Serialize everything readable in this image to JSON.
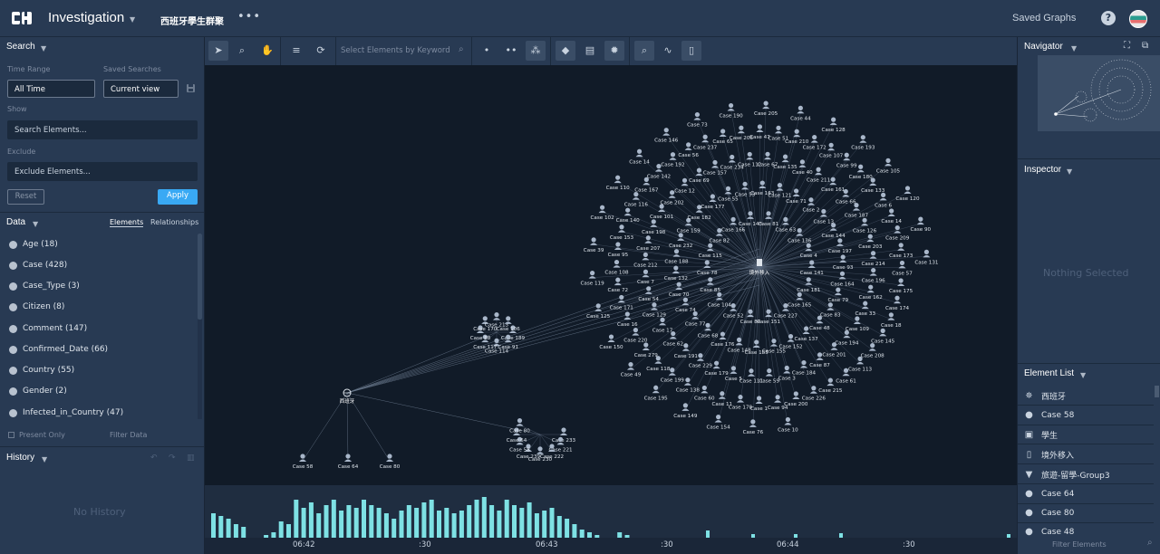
{
  "topbar": {
    "app_title": "Investigation",
    "graph_name": "西班牙學生群聚",
    "more": "•••",
    "saved_graphs": "Saved Graphs",
    "help": "?"
  },
  "search": {
    "title": "Search",
    "time_range_label": "Time Range",
    "time_range_value": "All Time",
    "saved_searches_label": "Saved Searches",
    "saved_searches_value": "Current view",
    "show_label": "Show",
    "show_placeholder": "Search Elements...",
    "exclude_label": "Exclude",
    "exclude_placeholder": "Exclude Elements...",
    "reset": "Reset",
    "apply": "Apply"
  },
  "data_panel": {
    "title": "Data",
    "tab_elements": "Elements",
    "tab_relationships": "Relationships",
    "items": [
      "Age (18)",
      "Case (428)",
      "Case_Type (3)",
      "Citizen (8)",
      "Comment (147)",
      "Confirmed_Date (66)",
      "Country (55)",
      "Gender (2)",
      "Infected_in_Country (47)"
    ],
    "present_only": "Present Only",
    "filter_data": "Filter Data"
  },
  "history": {
    "title": "History",
    "empty": "No History"
  },
  "toolbar": {
    "keyword_placeholder": "Select Elements by Keyword"
  },
  "graph": {
    "hub_label": "境外移入",
    "spain_label": "西班牙",
    "ring_labels": [
      "Case 141",
      "Case 181",
      "Case 165",
      "Case 227",
      "Case 151",
      "Case 84",
      "Case 52",
      "Case 104",
      "Case 85",
      "Case 78",
      "Case 115",
      "Case 82",
      "Case 166",
      "Case 143",
      "Case 81",
      "Case 63",
      "Case 136",
      "Case 4",
      "Case 79",
      "Case 83",
      "Case 48",
      "Case 137",
      "Case 152",
      "Case 155",
      "Case 185",
      "Case 148",
      "Case 176",
      "Case 68",
      "Case 77",
      "Case 74",
      "Case 70",
      "Case 132",
      "Case 188",
      "Case 232",
      "Case 159",
      "Case 182",
      "Case 177",
      "Case 55",
      "Case 53",
      "Case 163",
      "Case 121",
      "Case 71",
      "Case 2",
      "Case 13",
      "Case 144",
      "Case 197",
      "Case 93",
      "Case 164",
      "Case 194",
      "Case 201",
      "Case 87",
      "Case 184",
      "Case 3",
      "Case 59",
      "Case 111",
      "Case 5",
      "Case 179",
      "Case 229",
      "Case 191",
      "Case 62",
      "Case 17",
      "Case 129",
      "Case 54",
      "Case 7",
      "Case 212",
      "Case 207",
      "Case 198",
      "Case 101",
      "Case 202",
      "Case 12",
      "Case 69",
      "Case 157",
      "Case 234",
      "Case 112",
      "Case 67",
      "Case 135",
      "Case 40",
      "Case 211",
      "Case 161",
      "Case 66",
      "Case 187",
      "Case 126",
      "Case 203",
      "Case 214",
      "Case 196",
      "Case 162",
      "Case 33",
      "Case 109",
      "Case 215",
      "Case 226",
      "Case 200",
      "Case 94",
      "Case 1",
      "Case 178",
      "Case 11",
      "Case 60",
      "Case 138",
      "Case 199",
      "Case 118",
      "Case 279",
      "Case 220",
      "Case 16",
      "Case 171",
      "Case 72",
      "Case 108",
      "Case 95",
      "Case 153",
      "Case 140",
      "Case 116",
      "Case 167",
      "Case 142",
      "Case 192",
      "Case 56",
      "Case 237",
      "Case 65",
      "Case 206",
      "Case 47",
      "Case 51",
      "Case 210",
      "Case 172",
      "Case 107",
      "Case 99",
      "Case 180",
      "Case 133",
      "Case 6",
      "Case 14",
      "Case 209",
      "Case 173",
      "Case 57",
      "Case 175",
      "Case 174",
      "Case 18",
      "Case 145",
      "Case 208",
      "Case 113",
      "Case 61",
      "Case 10",
      "Case 76",
      "Case 154",
      "Case 149",
      "Case 195",
      "Case 49",
      "Case 150",
      "Case 125",
      "Case 119",
      "Case 39",
      "Case 102",
      "Case 110",
      "Case 14",
      "Case 146",
      "Case 73",
      "Case 190",
      "Case 205",
      "Case 44",
      "Case 128",
      "Case 193",
      "Case 105",
      "Case 120",
      "Case 90",
      "Case 131",
      "Case 189",
      "Case 91",
      "Case 114",
      "Case 117",
      "Case 88",
      "Case 170",
      "Case 213",
      "Case 106",
      "Case 233",
      "Case 221",
      "Case 222",
      "Case 230",
      "Case 239",
      "Case 58",
      "Case 64",
      "Case 80"
    ]
  },
  "timeline": {
    "ticks": [
      "06:42",
      ":30",
      "06:43",
      ":30",
      "06:44",
      ":30"
    ],
    "bars": [
      0.45,
      0.4,
      0.35,
      0.25,
      0.2,
      0.0,
      0.0,
      0.05,
      0.1,
      0.3,
      0.25,
      0.7,
      0.55,
      0.65,
      0.45,
      0.6,
      0.7,
      0.5,
      0.6,
      0.55,
      0.7,
      0.6,
      0.55,
      0.45,
      0.35,
      0.5,
      0.6,
      0.55,
      0.65,
      0.7,
      0.5,
      0.55,
      0.45,
      0.5,
      0.6,
      0.7,
      0.75,
      0.6,
      0.5,
      0.7,
      0.6,
      0.55,
      0.65,
      0.45,
      0.5,
      0.55,
      0.4,
      0.35,
      0.25,
      0.15,
      0.1,
      0.05,
      0.0,
      0.0,
      0.1,
      0.05,
      0.0,
      0.0,
      0.0
    ]
  },
  "navigator": {
    "title": "Navigator"
  },
  "inspector": {
    "title": "Inspector",
    "empty": "Nothing Selected"
  },
  "element_list": {
    "title": "Element List",
    "items": [
      {
        "icon": "globe-icon",
        "glyph": "✵",
        "label": "西班牙"
      },
      {
        "icon": "person-icon",
        "glyph": "●",
        "label": "Case 58"
      },
      {
        "icon": "briefcase-icon",
        "glyph": "▣",
        "label": "學生"
      },
      {
        "icon": "document-icon",
        "glyph": "▯",
        "label": "境外移入"
      },
      {
        "icon": "filter-icon",
        "glyph": "▼",
        "label": "旅遊-留學-Group3"
      },
      {
        "icon": "person-icon",
        "glyph": "●",
        "label": "Case 64"
      },
      {
        "icon": "person-icon",
        "glyph": "●",
        "label": "Case 80"
      },
      {
        "icon": "person-icon",
        "glyph": "●",
        "label": "Case 48"
      }
    ],
    "filter": "Filter Elements"
  },
  "colors": {
    "accent": "#39a9f4",
    "bar": "#7ee1e4",
    "bg": "#283a53"
  }
}
